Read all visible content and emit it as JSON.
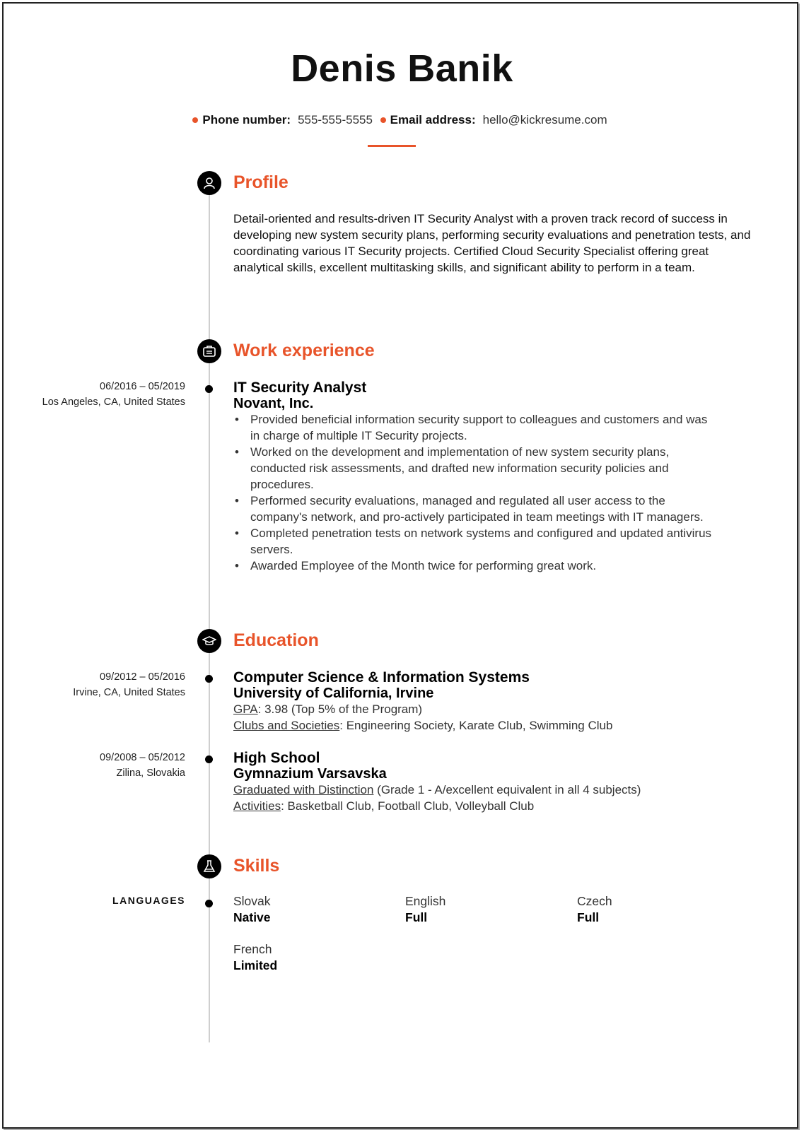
{
  "header": {
    "name": "Denis Banik",
    "phone_label": "Phone number:",
    "phone_value": "555-555-5555",
    "email_label": "Email address:",
    "email_value": "hello@kickresume.com",
    "accent_color": "#e8542a"
  },
  "profile": {
    "title": "Profile",
    "icon": "person-icon",
    "text": "Detail-oriented and results-driven IT Security Analyst with a proven track record of success in developing new system security plans, performing security evaluations and penetration tests, and coordinating various IT Security projects. Certified Cloud Security Specialist offering great analytical skills, excellent multitasking skills, and significant ability to perform in a team."
  },
  "work": {
    "title": "Work experience",
    "icon": "briefcase-icon",
    "jobs": [
      {
        "dates": "06/2016 – 05/2019",
        "location": "Los Angeles, CA, United States",
        "title": "IT Security Analyst",
        "company": "Novant, Inc.",
        "bullets": [
          "Provided beneficial information security support to colleagues and customers and was in charge of multiple IT Security projects.",
          "Worked on the development and implementation of new system security plans, conducted risk assessments, and drafted new information security policies and procedures.",
          "Performed security evaluations, managed and regulated all user access to the company's network, and pro-actively participated in team meetings with IT managers.",
          "Completed penetration tests on network systems and configured and updated antivirus servers.",
          "Awarded Employee of the Month twice for performing great work."
        ]
      }
    ]
  },
  "education": {
    "title": "Education",
    "icon": "graduation-cap-icon",
    "items": [
      {
        "dates": "09/2012 – 05/2016",
        "location": "Irvine, CA, United States",
        "degree": "Computer Science & Information Systems",
        "school": "University of California, Irvine",
        "line1_label": "GPA",
        "line1_text": ": 3.98 (Top 5% of the Program)",
        "line2_label": "Clubs and Societies",
        "line2_text": ": Engineering Society, Karate Club, Swimming Club"
      },
      {
        "dates": "09/2008 – 05/2012",
        "location": "Zilina, Slovakia",
        "degree": "High School",
        "school": "Gymnazium Varsavska",
        "line1_label": "Graduated with Distinction",
        "line1_text": " (Grade 1 - A/excellent equivalent in all 4 subjects)",
        "line2_label": "Activities",
        "line2_text": ": Basketball Club, Football Club, Volleyball Club"
      }
    ]
  },
  "skills": {
    "title": "Skills",
    "icon": "flask-icon",
    "languages_label": "LANGUAGES",
    "languages": [
      {
        "name": "Slovak",
        "level": "Native"
      },
      {
        "name": "English",
        "level": "Full"
      },
      {
        "name": "Czech",
        "level": "Full"
      },
      {
        "name": "French",
        "level": "Limited"
      }
    ]
  }
}
